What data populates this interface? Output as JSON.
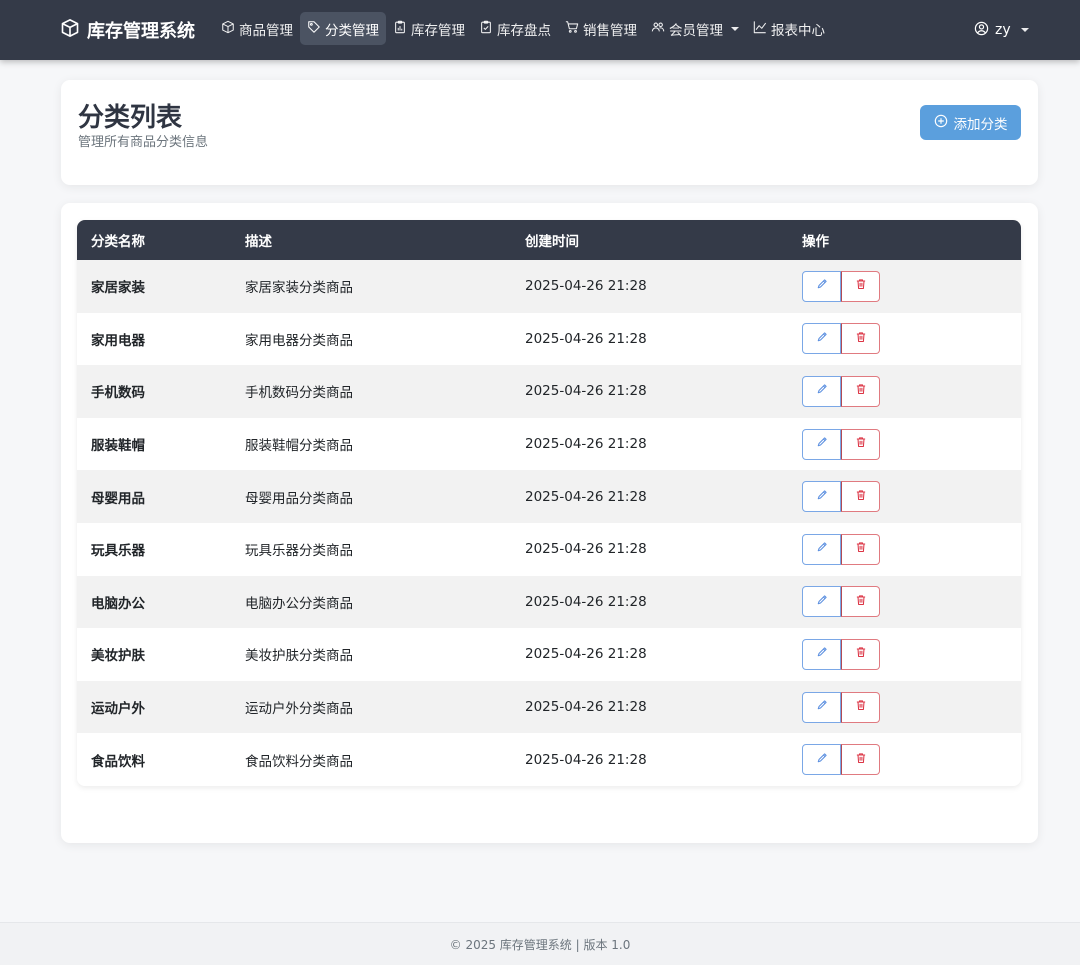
{
  "brand": {
    "title": "库存管理系统",
    "icon": "box-icon"
  },
  "nav": {
    "items": [
      {
        "label": "商品管理",
        "icon": "box-icon"
      },
      {
        "label": "分类管理",
        "icon": "tag-icon",
        "active": true
      },
      {
        "label": "库存管理",
        "icon": "clipboard-data-icon"
      },
      {
        "label": "库存盘点",
        "icon": "clipboard-check-icon"
      },
      {
        "label": "销售管理",
        "icon": "cart-icon"
      },
      {
        "label": "会员管理",
        "icon": "people-icon",
        "dropdown": true
      },
      {
        "label": "报表中心",
        "icon": "graph-icon"
      }
    ]
  },
  "user": {
    "name": "zy",
    "icon": "user-circle-icon"
  },
  "header": {
    "title": "分类列表",
    "subtitle": "管理所有商品分类信息",
    "add_button": "添加分类"
  },
  "table": {
    "columns": [
      "分类名称",
      "描述",
      "创建时间",
      "操作"
    ],
    "rows": [
      {
        "name": "家居家装",
        "desc": "家居家装分类商品",
        "time": "2025-04-26 21:28"
      },
      {
        "name": "家用电器",
        "desc": "家用电器分类商品",
        "time": "2025-04-26 21:28"
      },
      {
        "name": "手机数码",
        "desc": "手机数码分类商品",
        "time": "2025-04-26 21:28"
      },
      {
        "name": "服装鞋帽",
        "desc": "服装鞋帽分类商品",
        "time": "2025-04-26 21:28"
      },
      {
        "name": "母婴用品",
        "desc": "母婴用品分类商品",
        "time": "2025-04-26 21:28"
      },
      {
        "name": "玩具乐器",
        "desc": "玩具乐器分类商品",
        "time": "2025-04-26 21:28"
      },
      {
        "name": "电脑办公",
        "desc": "电脑办公分类商品",
        "time": "2025-04-26 21:28"
      },
      {
        "name": "美妆护肤",
        "desc": "美妆护肤分类商品",
        "time": "2025-04-26 21:28"
      },
      {
        "name": "运动户外",
        "desc": "运动户外分类商品",
        "time": "2025-04-26 21:28"
      },
      {
        "name": "食品饮料",
        "desc": "食品饮料分类商品",
        "time": "2025-04-26 21:28"
      }
    ]
  },
  "footer": {
    "text": "© 2025 库存管理系统 | 版本 1.0"
  },
  "colors": {
    "navbar": "#343a48",
    "primary": "#5b9fdd",
    "edit": "#5b8fe0",
    "delete": "#dc3545"
  }
}
